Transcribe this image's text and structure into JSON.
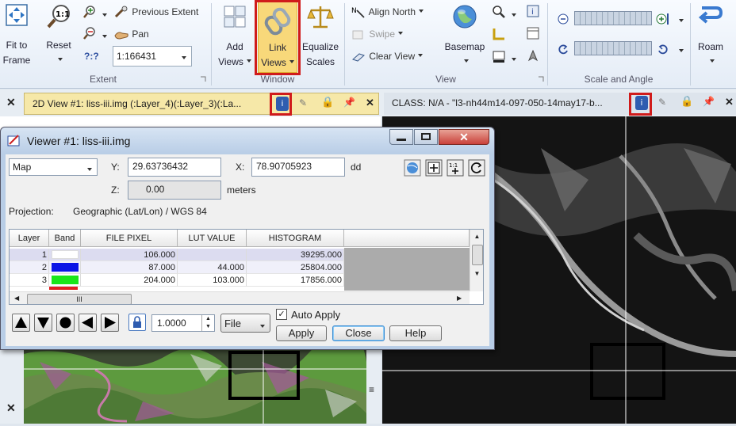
{
  "ribbon": {
    "fit_to_frame": [
      "Fit to",
      "Frame"
    ],
    "reset": "Reset",
    "previous_extent": "Previous Extent",
    "pan": "Pan",
    "unknown_tool": "?:?",
    "scale": "1:166431",
    "add_views": [
      "Add",
      "Views"
    ],
    "link_views": [
      "Link",
      "Views"
    ],
    "equalize_scales": [
      "Equalize",
      "Scales"
    ],
    "align_north": "Align North",
    "swipe": "Swipe",
    "clear_view": "Clear View",
    "basemap": "Basemap",
    "roam": "Roam",
    "groups": {
      "extent": "Extent",
      "window": "Window",
      "view": "View",
      "scale_angle": "Scale and Angle"
    }
  },
  "tabs": {
    "view2d": "2D View #1: liss-iii.img (:Layer_4)(:Layer_3)(:La...",
    "class": "CLASS: N/A - \"l3-nh44m14-097-050-14may17-b..."
  },
  "dialog": {
    "title": "Viewer #1:  liss-iii.img",
    "coord_mode": "Map",
    "y_label": "Y:",
    "y_value": "29.63736432",
    "x_label": "X:",
    "x_value": "78.90705923",
    "xy_unit": "dd",
    "z_label": "Z:",
    "z_value": "0.00",
    "z_unit": "meters",
    "projection_label": "Projection:",
    "projection_value": "Geographic (Lat/Lon) / WGS 84",
    "table": {
      "headers": [
        "Layer",
        "Band",
        "FILE PIXEL",
        "LUT VALUE",
        "HISTOGRAM"
      ],
      "rows": [
        {
          "layer": "1",
          "band_color": "#ffffff",
          "file_pixel": "106.000",
          "lut_value": "",
          "histogram": "39295.000"
        },
        {
          "layer": "2",
          "band_color": "#0a14e6",
          "file_pixel": "87.000",
          "lut_value": "44.000",
          "histogram": "25804.000"
        },
        {
          "layer": "3",
          "band_color": "#19e619",
          "file_pixel": "204.000",
          "lut_value": "103.000",
          "histogram": "17856.000"
        }
      ]
    },
    "hscroll_grip": "III",
    "zoom_value": "1.0000",
    "file_menu": "File",
    "auto_apply": "Auto Apply",
    "apply": "Apply",
    "close": "Close",
    "help": "Help"
  },
  "colors": {
    "highlight": "#d01b1b",
    "tab_active": "#f6e8a8",
    "close_red": "#c9413a"
  }
}
